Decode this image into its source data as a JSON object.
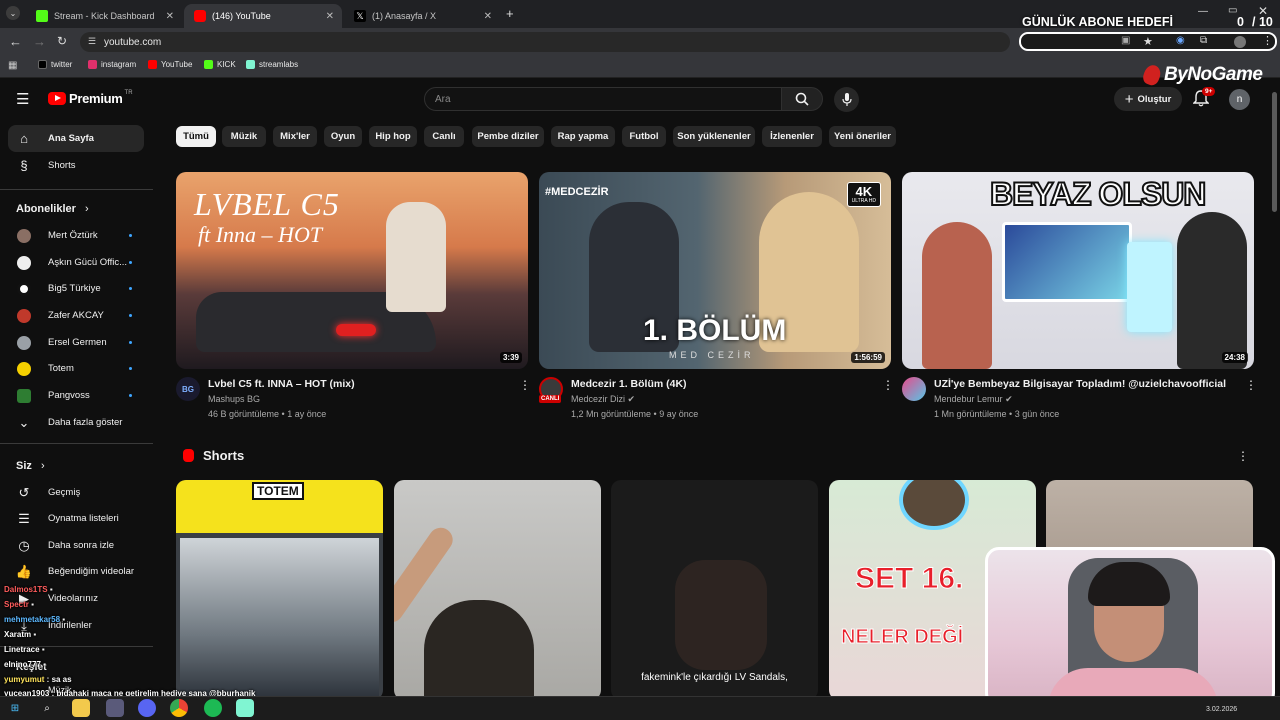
{
  "browser": {
    "tabs": [
      {
        "title": "Stream - Kick Dashboard",
        "color": "#53fc18"
      },
      {
        "title": "(146) YouTube",
        "color": "#ff0000"
      },
      {
        "title": "(1) Anasayfa / X",
        "color": "#000000"
      }
    ],
    "url": "youtube.com",
    "bookmarks": [
      {
        "label": "twitter",
        "color": "#000000"
      },
      {
        "label": "instagram",
        "color": "#e1306c"
      },
      {
        "label": "YouTube",
        "color": "#ff0000"
      },
      {
        "label": "KICK",
        "color": "#53fc18"
      },
      {
        "label": "streamlabs",
        "color": "#80f5d2"
      }
    ]
  },
  "overlay": {
    "goal_label": "GÜNLÜK ABONE HEDEFİ",
    "goal_count": "0",
    "goal_total": "/ 10",
    "brand": "ByNoGame"
  },
  "youtube": {
    "logo_text": "Premium",
    "logo_sup": "TR",
    "search_placeholder": "Ara",
    "create_label": "Oluştur",
    "notif_badge": "9+",
    "account_initial": "n",
    "chips": [
      "Tümü",
      "Müzik",
      "Mix'ler",
      "Oyun",
      "Hip hop",
      "Canlı",
      "Pembe diziler",
      "Rap yapma",
      "Futbol",
      "Son yüklenenler",
      "İzlenenler",
      "Yeni öneriler"
    ],
    "sidebar": {
      "home": "Ana Sayfa",
      "shorts": "Shorts",
      "subs_title": "Abonelikler",
      "subs": [
        {
          "name": "Mert Öztürk",
          "color": "#8a6f64"
        },
        {
          "name": "Aşkın Gücü Offic...",
          "color": "#eeeeee"
        },
        {
          "name": "Big5 Türkiye",
          "color": "#ffffff"
        },
        {
          "name": "Zafer AKCAY",
          "color": "#c0392b"
        },
        {
          "name": "Ersel Germen",
          "color": "#9aa0a6"
        },
        {
          "name": "Totem",
          "color": "#f5d000"
        },
        {
          "name": "Pangvoss",
          "color": "#2e7d32"
        }
      ],
      "show_more": "Daha fazla göster",
      "you_title": "Siz",
      "you_items": [
        "Geçmiş",
        "Oynatma listeleri",
        "Daha sonra izle",
        "Beğendiğim videolar",
        "Videolarınız",
        "İndirilenler"
      ],
      "explore": "Keşfet",
      "music": "Müzik"
    },
    "videos": [
      {
        "thumb_title": "LVBEL C5",
        "thumb_sub": "ft Inna – HOT",
        "duration": "3:39",
        "title": "Lvbel C5 ft. INNA – HOT (mix)",
        "channel": "Mashups BG",
        "meta": "46 B görüntüleme • 1 ay önce",
        "avatar": "BG"
      },
      {
        "thumb_title": "1. BÖLÜM",
        "thumb_sub": "MED CEZİR",
        "thumb_tag": "#MEDCEZİR",
        "thumb_badge": "4K",
        "thumb_badge_sub": "ULTRA HD",
        "duration": "1:56:59",
        "title": "Medcezir 1. Bölüm (4K)",
        "channel": "Medcezir Dizi",
        "meta": "1,2 Mn görüntüleme • 9 ay önce",
        "avatar_badge": "CANLI"
      },
      {
        "thumb_title": "BEYAZ OLSUN",
        "duration": "24:38",
        "title": "UZİ'ye Bembeyaz Bilgisayar Topladım! @uzielchavoofficial",
        "channel": "Mendebur Lemur",
        "meta": "1 Mn görüntüleme • 3 gün önce"
      }
    ],
    "shorts_title": "Shorts",
    "shorts": [
      {
        "label": "TOTEM"
      },
      {
        "label": ""
      },
      {
        "caption": "fakemink'le çıkardığı LV Sandals,"
      },
      {
        "big": "SET 16.",
        "small": "NELER DEĞİ"
      },
      {
        "label": ""
      }
    ]
  },
  "chat": [
    {
      "user": "Dalmos1TS",
      "msg": "",
      "color": "#ff5c5c"
    },
    {
      "user": "Spectr",
      "msg": "",
      "color": "#ff5c5c"
    },
    {
      "user": "mehmetakar58",
      "msg": "",
      "color": "#5cb8ff"
    },
    {
      "user": "Xaratm",
      "msg": "",
      "color": "#ffffff"
    },
    {
      "user": "Linetrace",
      "msg": "",
      "color": "#ffffff"
    },
    {
      "user": "elnino777",
      "msg": "",
      "color": "#ffffff"
    },
    {
      "user": "yumyumut",
      "msg": "sa as",
      "color": "#ffe45c"
    },
    {
      "user": "yucean1903",
      "msg": "bidahaki maça ne getirelim hediye sana @bburhanjk",
      "color": "#ffffff"
    }
  ],
  "taskbar": {
    "date": "3.02.2026"
  }
}
